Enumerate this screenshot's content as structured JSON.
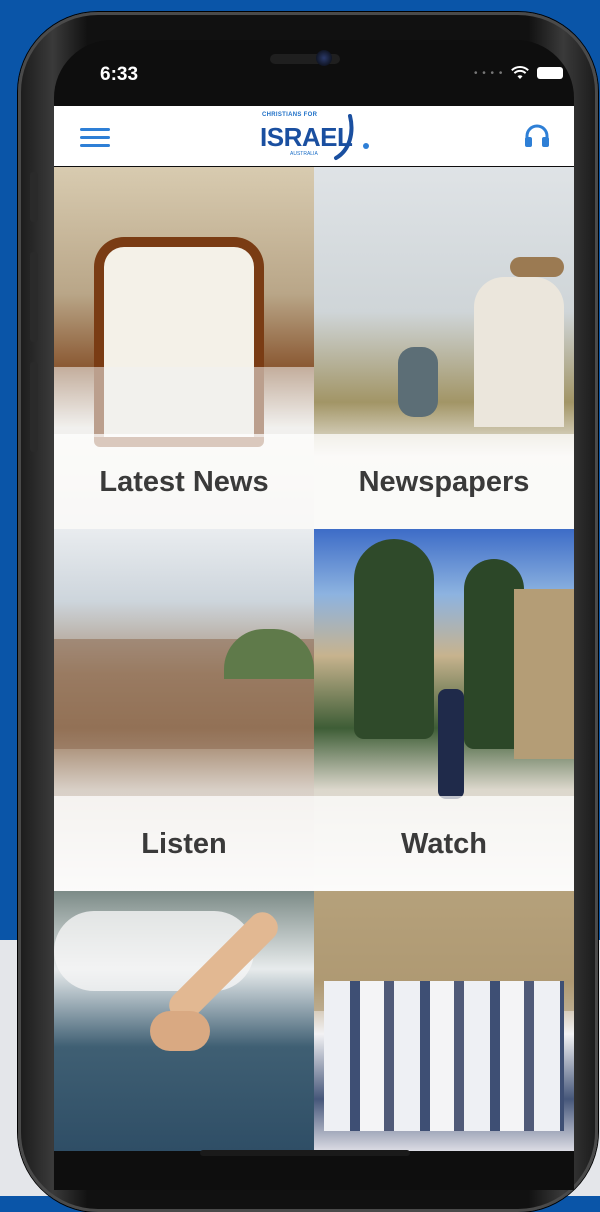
{
  "status_bar": {
    "time": "6:33"
  },
  "header": {
    "logo_small": "CHRISTIANS FOR",
    "logo_main": "ISRAEL",
    "logo_sub": "AUSTRALIA",
    "menu_icon": "hamburger-icon",
    "audio_icon": "headphones-icon"
  },
  "tiles": [
    {
      "label": "Latest News"
    },
    {
      "label": "Newspapers"
    },
    {
      "label": "Listen"
    },
    {
      "label": "Watch"
    }
  ],
  "colors": {
    "background": "#0a55a8",
    "accent": "#2e7fd6",
    "logo": "#1a4fa0"
  }
}
